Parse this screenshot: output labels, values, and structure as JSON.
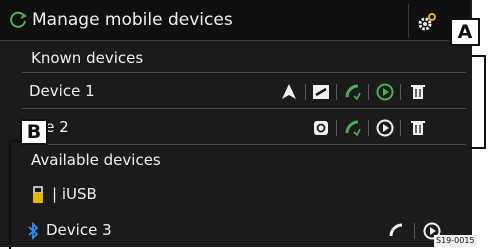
{
  "window": {
    "title": "Manage mobile devices",
    "icon": "refresh-icon",
    "settings_icon": "gear-icon"
  },
  "known_devices": {
    "heading": "Known devices",
    "items": [
      {
        "label": "Device 1",
        "icons": [
          "navigation-arrow-icon",
          "mirror-link-icon",
          "phone-call-icon",
          "media-play-icon",
          "trash-icon"
        ]
      },
      {
        "label": "Device 2",
        "label_visible": "vice 2",
        "icons": [
          "car-play-icon",
          "phone-call-icon",
          "media-play-icon",
          "trash-icon"
        ]
      }
    ]
  },
  "available_devices": {
    "heading": "Available devices",
    "items": [
      {
        "label": "| iUSB",
        "icons": [
          "usb-stick-icon"
        ]
      },
      {
        "label": "Device 3",
        "icons": [
          "bluetooth-icon",
          "phone-call-icon",
          "media-play-icon"
        ]
      }
    ]
  },
  "callouts": {
    "a": "A",
    "b": "B"
  },
  "figure_code": "S19-0015",
  "colors": {
    "background": "#1b1b1b",
    "text": "#f0f0f0",
    "accent_green": "#4caf50",
    "bluetooth_blue": "#2b8ff0",
    "separator": "#4a4a4a"
  }
}
